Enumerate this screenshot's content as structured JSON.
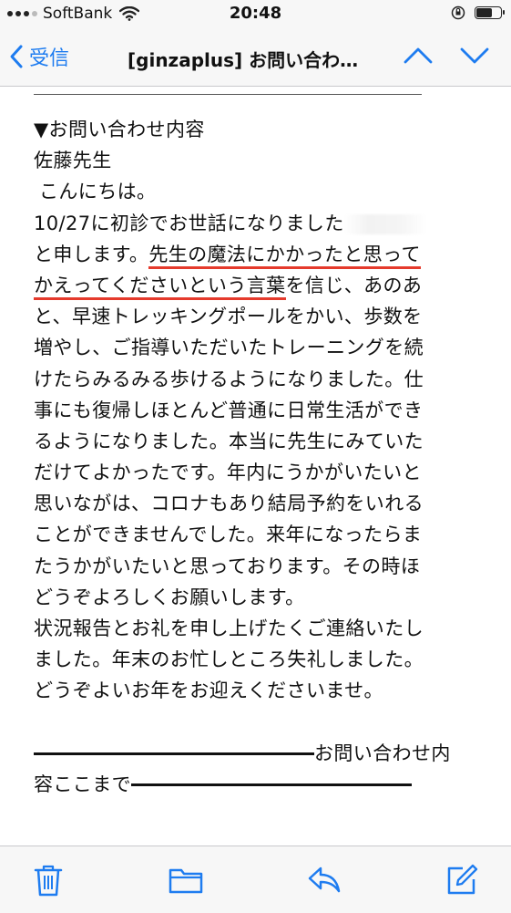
{
  "status_bar": {
    "carrier": "SoftBank",
    "time": "20:48",
    "battery_level": 0.7
  },
  "navbar": {
    "back_label": "受信",
    "title": "[ginzaplus] お問い合わ…"
  },
  "email": {
    "lines": [
      "▼お問い合わせ内容",
      "佐藤先生",
      "こんにちは。",
      "10/27に初診でお世話になりました",
      "と申します。|先生の魔法にかかったと思って",
      "かえってくださいという言葉|を信じ、あのあ",
      "と、早速トレッキングポールをかい、歩数を",
      "増やし、ご指導いただいたトレーニングを続",
      "けたらみるみる歩けるようになりました。仕",
      "事にも復帰しほとんど普通に日常生活ができ",
      "るようになりました。本当に先生にみていた",
      "だけてよかったです。年内にうかがいたいと",
      "思いながは、コロナもあり結局予約をいれる",
      "ことができませんでした。来年になったらま",
      "たうかがいたいと思っております。その時ほ",
      "どうぞよろしくお願いします。",
      "状況報告とお礼を申し上げたくご連絡いたし",
      "ました。年末のお忙しところ失礼しました。",
      "どうぞよいお年をお迎えくださいませ。",
      "",
      "お問い合わせ内",
      "容ここまで"
    ],
    "l4a": "と申します。",
    "l4b": "先生の魔法にかかったと思って",
    "l5a": "かえってくださいという言葉",
    "l5b": "を信じ、あのあ"
  },
  "toolbar": {
    "icons": [
      "trash-icon",
      "folder-icon",
      "reply-icon",
      "compose-icon"
    ]
  },
  "colors": {
    "accent": "#1e7cf0",
    "highlight": "#e53a2c"
  }
}
